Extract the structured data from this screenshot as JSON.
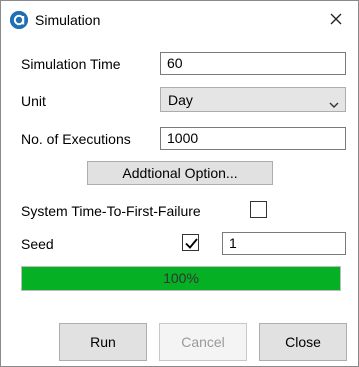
{
  "window": {
    "title": "Simulation",
    "app_icon": "a-logo-icon",
    "close_icon": "close-icon"
  },
  "fields": {
    "simulation_time": {
      "label": "Simulation Time",
      "value": "60"
    },
    "unit": {
      "label": "Unit",
      "selected": "Day",
      "icon": "chevron-down-icon"
    },
    "executions": {
      "label": "No. of Executions",
      "value": "1000"
    }
  },
  "additional_button": {
    "label": "Addtional Option..."
  },
  "ttff": {
    "label": "System Time-To-First-Failure",
    "checked": false
  },
  "seed": {
    "label": "Seed",
    "checked": true,
    "value": "1"
  },
  "progress": {
    "value": 1.0,
    "text": "100%",
    "color": "#06b025"
  },
  "buttons": {
    "run": "Run",
    "cancel": "Cancel",
    "close": "Close"
  }
}
